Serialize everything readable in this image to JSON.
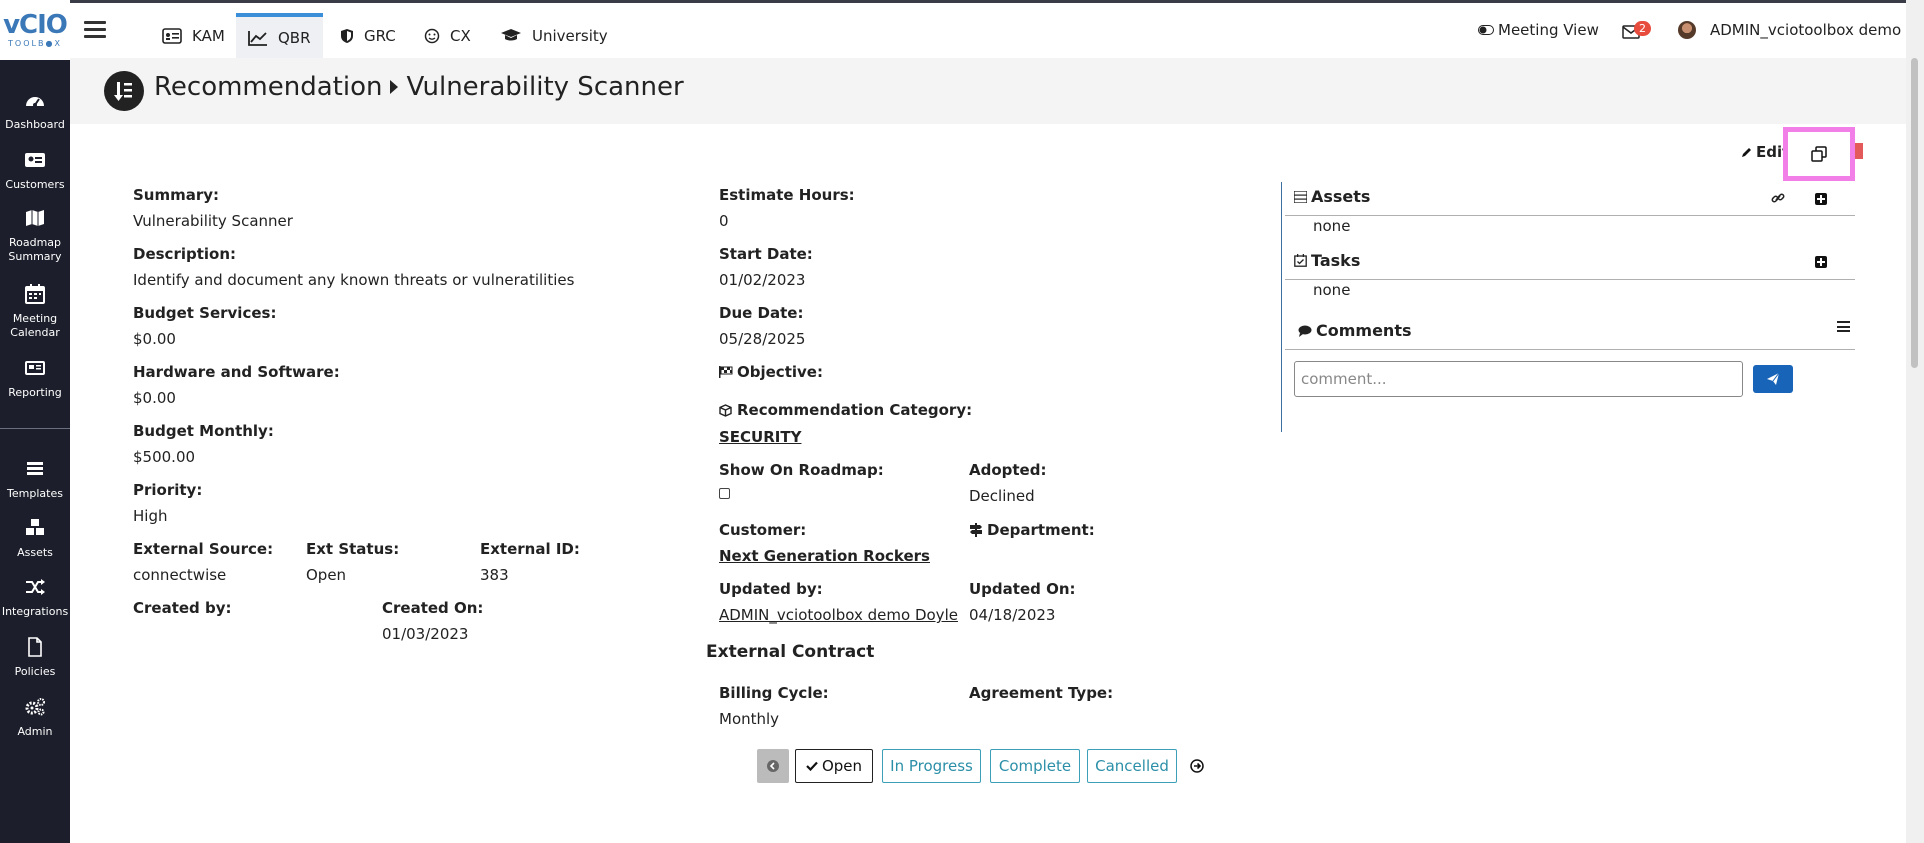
{
  "logo": {
    "big": "vCIO",
    "small": "TOOLB●X"
  },
  "sidebar": {
    "items": [
      {
        "label": "Dashboard",
        "icon": "dashboard-icon"
      },
      {
        "label": "Customers",
        "icon": "id-card-icon"
      },
      {
        "label": "Roadmap Summary",
        "icon": "map-icon"
      },
      {
        "label": "Meeting Calendar",
        "icon": "calendar-icon"
      },
      {
        "label": "Reporting",
        "icon": "newspaper-icon"
      },
      {
        "label": "Templates",
        "icon": "layers-icon"
      },
      {
        "label": "Assets",
        "icon": "cubes-icon"
      },
      {
        "label": "Integrations",
        "icon": "shuffle-icon"
      },
      {
        "label": "Policies",
        "icon": "file-icon"
      },
      {
        "label": "Admin",
        "icon": "gears-icon"
      }
    ]
  },
  "topbar": {
    "tabs": [
      {
        "label": "KAM",
        "icon": "id-card-icon"
      },
      {
        "label": "QBR",
        "icon": "chart-line-icon"
      },
      {
        "label": "GRC",
        "icon": "shield-icon"
      },
      {
        "label": "CX",
        "icon": "smile-icon"
      },
      {
        "label": "University",
        "icon": "graduation-cap-icon"
      }
    ],
    "active_tab": "QBR",
    "meeting_view": "Meeting View",
    "mail_count": "2",
    "user": "ADMIN_vciotoolbox demo"
  },
  "header": {
    "breadcrumb_parent": "Recommendation",
    "breadcrumb_current": "Vulnerability Scanner"
  },
  "actions": {
    "edit": "Edit"
  },
  "left": {
    "summary_label": "Summary:",
    "summary": "Vulnerability Scanner",
    "description_label": "Description:",
    "description": "Identify and document any known threats or vulneratilities",
    "budget_services_label": "Budget Services:",
    "budget_services": "$0.00",
    "hw_sw_label": "Hardware and Software:",
    "hw_sw": "$0.00",
    "budget_monthly_label": "Budget Monthly:",
    "budget_monthly": "$500.00",
    "priority_label": "Priority:",
    "priority": "High",
    "ext_source_label": "External Source:",
    "ext_source": "connectwise",
    "ext_status_label": "Ext Status:",
    "ext_status": "Open",
    "ext_id_label": "External ID:",
    "ext_id": "383",
    "created_by_label": "Created by:",
    "created_on_label": "Created On:",
    "created_on": "01/03/2023"
  },
  "middle": {
    "estimate_hours_label": "Estimate Hours:",
    "estimate_hours": "0",
    "start_date_label": "Start Date:",
    "start_date": "01/02/2023",
    "due_date_label": "Due Date:",
    "due_date": "05/28/2025",
    "objective_label": "Objective:",
    "category_label": "Recommendation Category:",
    "category": "SECURITY",
    "show_roadmap_label": "Show On Roadmap:",
    "show_roadmap_checked": false,
    "adopted_label": "Adopted:",
    "adopted": "Declined",
    "customer_label": "Customer:",
    "customer": "Next Generation Rockers",
    "department_label": "Department:",
    "updated_by_label": "Updated by:",
    "updated_by": "ADMIN_vciotoolbox demo Doyle",
    "updated_on_label": "Updated On:",
    "updated_on": "04/18/2023",
    "external_contract_title": "External Contract",
    "billing_cycle_label": "Billing Cycle:",
    "billing_cycle": "Monthly",
    "agreement_type_label": "Agreement Type:"
  },
  "right": {
    "assets_title": "Assets",
    "assets_none": "none",
    "tasks_title": "Tasks",
    "tasks_none": "none",
    "comments_title": "Comments",
    "comment_placeholder": "comment..."
  },
  "status": {
    "open": "Open",
    "in_progress": "In Progress",
    "complete": "Complete",
    "cancelled": "Cancelled",
    "current": "Open"
  },
  "colors": {
    "sidebar": "#1c1f2b",
    "accent": "#3b8fd9",
    "status_btn": "#2b8fa8",
    "highlight": "#f27ee8",
    "send_btn": "#1864b8"
  }
}
